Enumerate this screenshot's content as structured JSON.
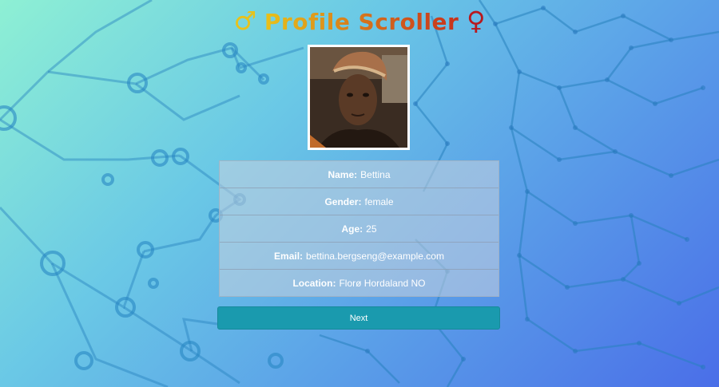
{
  "header": {
    "title": "Profile Scroller",
    "male_symbol": "♂",
    "female_symbol": "♀"
  },
  "profile": {
    "photo": "person-photo",
    "fields": [
      {
        "label": "Name:",
        "value": "Bettina"
      },
      {
        "label": "Gender:",
        "value": "female"
      },
      {
        "label": "Age:",
        "value": "25"
      },
      {
        "label": "Email:",
        "value": "bettina.bergseng@example.com"
      },
      {
        "label": "Location:",
        "value": "Florø Hordaland NO"
      }
    ]
  },
  "actions": {
    "next_label": "Next"
  },
  "colors": {
    "accent": "#1a9aae",
    "male": "#e7c21c",
    "female": "#b8181e"
  }
}
